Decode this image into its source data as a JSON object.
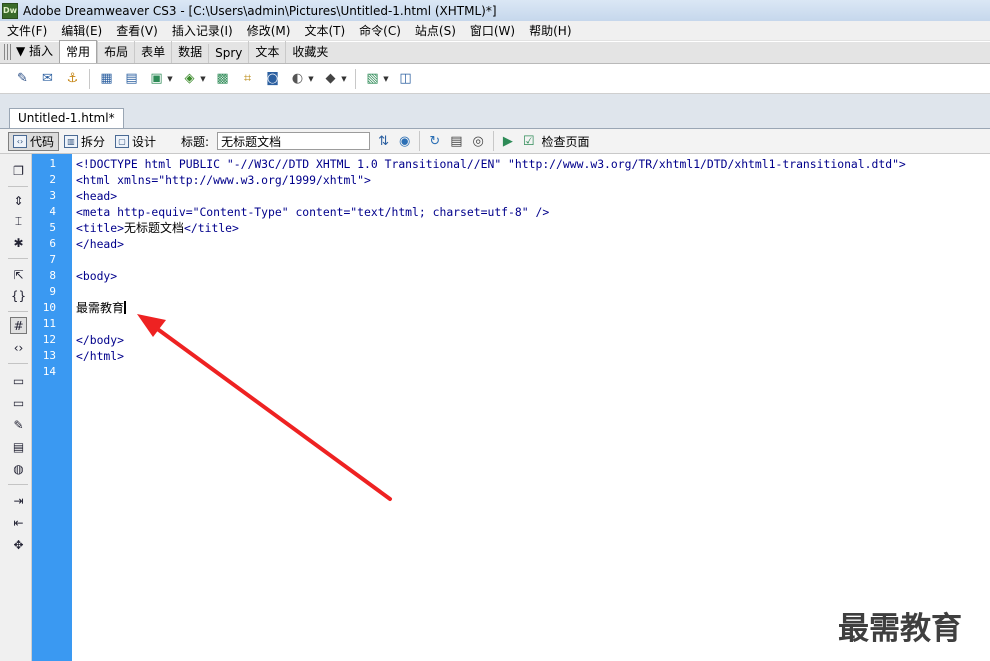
{
  "window": {
    "app_icon": "Dw",
    "title": "Adobe Dreamweaver CS3 - [C:\\Users\\admin\\Pictures\\Untitled-1.html (XHTML)*]"
  },
  "menu": [
    "文件(F)",
    "编辑(E)",
    "查看(V)",
    "插入记录(I)",
    "修改(M)",
    "文本(T)",
    "命令(C)",
    "站点(S)",
    "窗口(W)",
    "帮助(H)"
  ],
  "insert_panel": {
    "label": "▼ 插入",
    "tabs": [
      "常用",
      "布局",
      "表单",
      "数据",
      "Spry",
      "文本",
      "收藏夹"
    ],
    "active_tab": "常用"
  },
  "document": {
    "tab_label": "Untitled-1.html*",
    "views": {
      "code": "代码",
      "split": "拆分",
      "design": "设计"
    },
    "title_label": "标题:",
    "title_value": "无标题文档",
    "check_page": "检查页面"
  },
  "editor": {
    "line_numbers": [
      "1",
      "2",
      "3",
      "4",
      "5",
      "6",
      "7",
      "8",
      "9",
      "10",
      "11",
      "12",
      "13",
      "14"
    ],
    "lines": {
      "l1": "<!DOCTYPE html PUBLIC \"-//W3C//DTD XHTML 1.0 Transitional//EN\" \"http://www.w3.org/TR/xhtml1/DTD/xhtml1-transitional.dtd\">",
      "l2": "<html xmlns=\"http://www.w3.org/1999/xhtml\">",
      "l3": "<head>",
      "l4": "<meta http-equiv=\"Content-Type\" content=\"text/html; charset=utf-8\" />",
      "l5_open": "<title>",
      "l5_text": "无标题文档",
      "l5_close": "</title>",
      "l6": "</head>",
      "l8": "<body>",
      "l10": "最需教育",
      "l12": "</body>",
      "l13": "</html>"
    }
  },
  "watermark": "最需教育",
  "colors": {
    "gutter": "#3a99f2",
    "tag": "#00008b",
    "arrow": "#ee2222"
  }
}
